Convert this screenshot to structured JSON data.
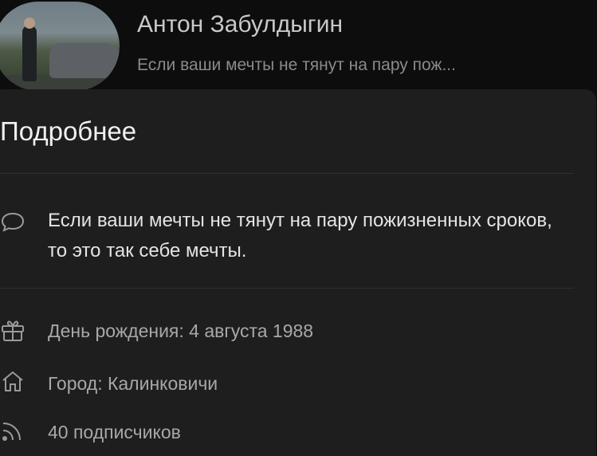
{
  "profile": {
    "name": "Антон Забулдыгин",
    "status_short": "Если ваши мечты не тянут на пару пож..."
  },
  "details": {
    "title": "Подробнее",
    "about": "Если ваши мечты не тянут на пару пожизненных сроков, то это так себе мечты.",
    "items": [
      {
        "icon": "gift-icon",
        "text": "День рождения: 4 августа 1988"
      },
      {
        "icon": "home-icon",
        "text": "Город: Калинковичи"
      },
      {
        "icon": "rss-icon",
        "text": "40 подписчиков"
      }
    ]
  }
}
